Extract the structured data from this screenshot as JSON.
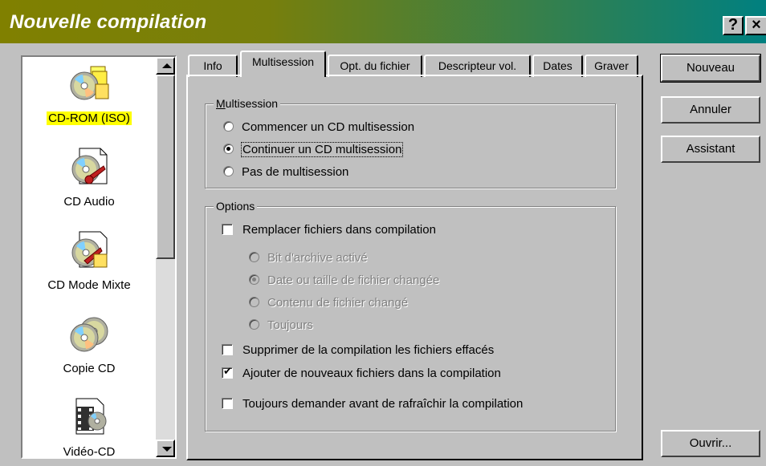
{
  "window": {
    "title": "Nouvelle compilation",
    "help_label": "?",
    "close_label": "×"
  },
  "compilation_types": [
    {
      "label": "CD-ROM (ISO)",
      "icon": "cd-rom-iso-icon",
      "selected": true
    },
    {
      "label": "CD Audio",
      "icon": "cd-audio-icon",
      "selected": false
    },
    {
      "label": "CD Mode Mixte",
      "icon": "cd-mixed-mode-icon",
      "selected": false
    },
    {
      "label": "Copie CD",
      "icon": "copy-cd-icon",
      "selected": false
    },
    {
      "label": "Vidéo-CD",
      "icon": "video-cd-icon",
      "selected": false
    }
  ],
  "tabs": [
    {
      "label": "Info"
    },
    {
      "label": "Multisession",
      "active": true
    },
    {
      "label": "Opt. du fichier"
    },
    {
      "label": "Descripteur vol."
    },
    {
      "label": "Dates"
    },
    {
      "label": "Graver"
    }
  ],
  "multisession_group": {
    "title": "Multisession",
    "options": [
      {
        "label": "Commencer un CD multisession",
        "checked": false
      },
      {
        "label": "Continuer un CD multisession",
        "checked": true
      },
      {
        "label": "Pas de multisession",
        "checked": false
      }
    ]
  },
  "options_group": {
    "title": "Options",
    "replace_files": {
      "label": "Remplacer fichiers dans compilation",
      "checked": false
    },
    "sub_options": [
      {
        "label": "Bit d'archive activé",
        "checked": false
      },
      {
        "label": "Date ou taille de fichier changée",
        "checked": true
      },
      {
        "label": "Contenu de fichier changé",
        "checked": false
      },
      {
        "label": "Toujours",
        "checked": false
      }
    ],
    "delete_removed": {
      "label": "Supprimer de la compilation les fichiers effacés",
      "checked": false
    },
    "add_new": {
      "label": "Ajouter de nouveaux fichiers dans la compilation",
      "checked": true
    },
    "ask_refresh": {
      "label": "Toujours demander avant de rafraîchir la compilation",
      "checked": false
    }
  },
  "buttons": {
    "new": "Nouveau",
    "cancel": "Annuler",
    "wizard": "Assistant",
    "open": "Ouvrir..."
  },
  "colors": {
    "title_gradient_start": "#808000",
    "title_gradient_end": "#008080",
    "selection_highlight": "#ffff00"
  }
}
